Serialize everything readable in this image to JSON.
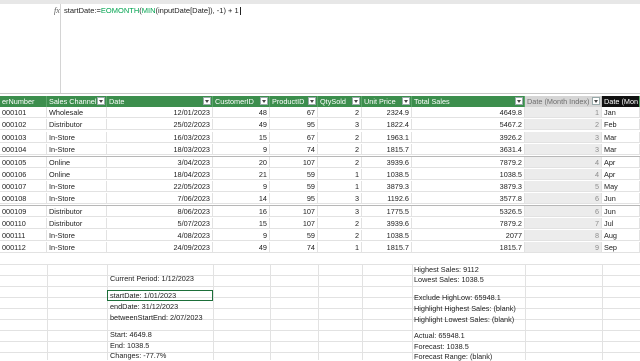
{
  "formula": {
    "prefix": "startDate:=",
    "fn1": "EOMONTH",
    "paren": "(",
    "fn2": "MIN",
    "args": "(inputDate[Date]), -1) + 1"
  },
  "fx_label": "fx",
  "table": {
    "headers": [
      "erNumber",
      "Sales Channel",
      "Date",
      "CustomerID",
      "ProductID",
      "QtySold",
      "Unit Price",
      "Total Sales",
      "Date (Month Index)",
      "Date (Mon"
    ],
    "rows": [
      [
        "000101",
        "Wholesale",
        "12/01/2023",
        "48",
        "67",
        "2",
        "2324.9",
        "4649.8",
        "1",
        "Jan"
      ],
      [
        "000102",
        "Distributor",
        "25/02/2023",
        "49",
        "95",
        "3",
        "1822.4",
        "5467.2",
        "2",
        "Feb"
      ],
      [
        "000103",
        "In-Store",
        "16/03/2023",
        "15",
        "67",
        "2",
        "1963.1",
        "3926.2",
        "3",
        "Mar"
      ],
      [
        "000104",
        "In-Store",
        "18/03/2023",
        "9",
        "74",
        "2",
        "1815.7",
        "3631.4",
        "3",
        "Mar"
      ],
      [
        "000105",
        "Online",
        "3/04/2023",
        "20",
        "107",
        "2",
        "3939.6",
        "7879.2",
        "4",
        "Apr"
      ],
      [
        "000106",
        "Online",
        "18/04/2023",
        "21",
        "59",
        "1",
        "1038.5",
        "1038.5",
        "4",
        "Apr"
      ],
      [
        "000107",
        "In-Store",
        "22/05/2023",
        "9",
        "59",
        "1",
        "3879.3",
        "3879.3",
        "5",
        "May"
      ],
      [
        "000108",
        "In-Store",
        "7/06/2023",
        "14",
        "95",
        "3",
        "1192.6",
        "3577.8",
        "6",
        "Jun"
      ],
      [
        "000109",
        "Distributor",
        "8/06/2023",
        "16",
        "107",
        "3",
        "1775.5",
        "5326.5",
        "6",
        "Jun"
      ],
      [
        "000110",
        "Distributor",
        "5/07/2023",
        "15",
        "107",
        "2",
        "3939.6",
        "7879.2",
        "7",
        "Jul"
      ],
      [
        "000111",
        "In-Store",
        "4/08/2023",
        "9",
        "59",
        "2",
        "1038.5",
        "2077",
        "8",
        "Aug"
      ],
      [
        "000112",
        "In-Store",
        "24/09/2023",
        "49",
        "74",
        "1",
        "1815.7",
        "1815.7",
        "9",
        "Sep"
      ]
    ]
  },
  "summary": {
    "current_period": "Current Period: 1/12/2023",
    "start_date": "startDate: 1/01/2023",
    "end_date": "endDate: 31/12/2023",
    "between": "betweenStartEnd: 2/07/2023",
    "start": "Start: 4649.8",
    "end": "End: 1038.5",
    "changes": "Changes: -77.7%",
    "highest_sales": "Highest Sales: 9112",
    "lowest_sales": "Lowest Sales: 1038.5",
    "exclude_highlow": "Exclude HighLow: 65948.1",
    "highlight_highest": "Highlight Highest Sales: (blank)",
    "highlight_lowest": "Highlight Lowest Sales: (blank)",
    "actual": "Actual: 65948.1",
    "forecast": "Forecast: 1038.5",
    "forecast_range": "Forecast Range: (blank)"
  },
  "colors": {
    "header_green": "#3c8e4d",
    "formula_fn": "#00a34f",
    "index_col_bg": "#ececec"
  }
}
